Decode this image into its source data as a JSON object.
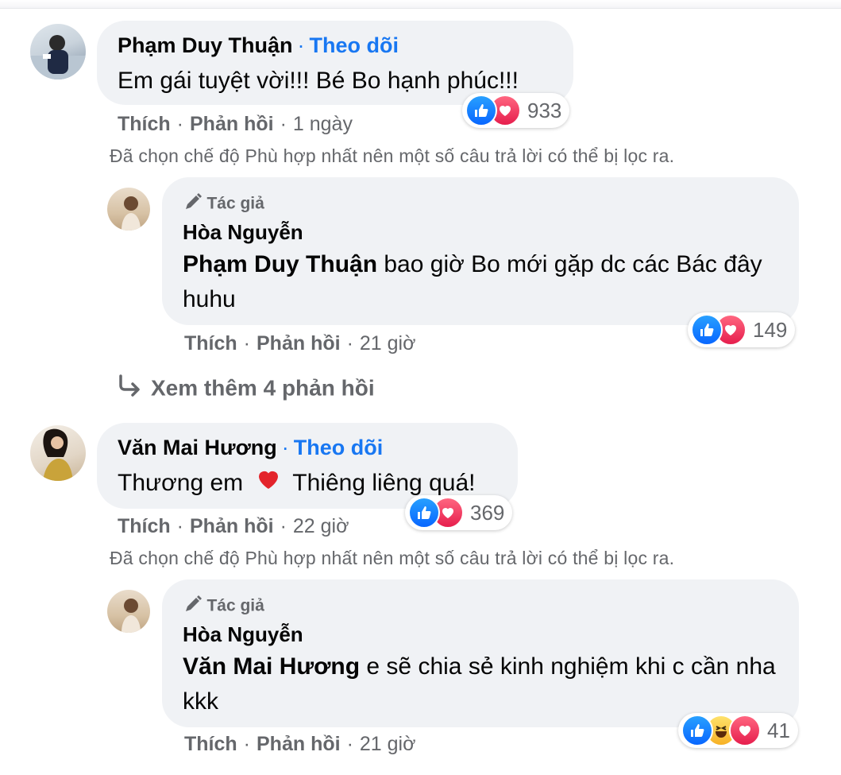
{
  "comments": [
    {
      "name": "Phạm Duy Thuận",
      "follow": "Theo dõi",
      "text": "Em gái tuyệt vời!!! Bé Bo hạnh phúc!!!",
      "reactions_count": "933",
      "like": "Thích",
      "reply": "Phản hồi",
      "time": "1 ngày",
      "notice": "Đã chọn chế độ Phù hợp nhất nên một số câu trả lời có thể bị lọc ra.",
      "reply_item": {
        "author_tag": "Tác giả",
        "name": "Hòa Nguyễn",
        "mention": "Phạm Duy Thuận",
        "text": " bao giờ Bo mới gặp dc các Bác đây huhu",
        "reactions_count": "149",
        "like": "Thích",
        "reply": "Phản hồi",
        "time": "21 giờ"
      },
      "see_more": "Xem thêm 4 phản hồi"
    },
    {
      "name": "Văn Mai Hương",
      "follow": "Theo dõi",
      "text_before": "Thương em",
      "text_after": "Thiêng liêng quá!",
      "reactions_count": "369",
      "like": "Thích",
      "reply": "Phản hồi",
      "time": "22 giờ",
      "notice": "Đã chọn chế độ Phù hợp nhất nên một số câu trả lời có thể bị lọc ra.",
      "reply_item": {
        "author_tag": "Tác giả",
        "name": "Hòa Nguyễn",
        "mention": "Văn Mai Hương",
        "text": " e sẽ chia sẻ kinh nghiệm khi c cần nha kkk",
        "reactions_count": "41",
        "like": "Thích",
        "reply": "Phản hồi",
        "time": "21 giờ"
      }
    }
  ],
  "icons": [
    "like-icon",
    "love-icon",
    "haha-icon",
    "pen-icon",
    "reply-arrow-icon",
    "heart-emoji-icon"
  ],
  "colors": {
    "link": "#1877f2",
    "bubble": "#f0f2f5",
    "meta": "#65676b"
  }
}
